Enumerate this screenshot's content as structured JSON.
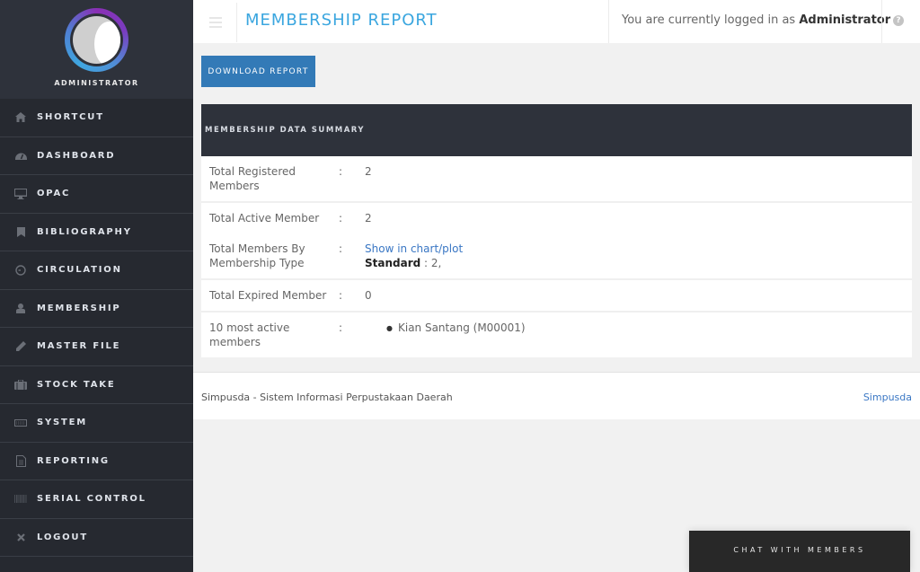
{
  "profile": {
    "name": "ADMINISTRATOR"
  },
  "sidebar": {
    "items": [
      {
        "label": "SHORTCUT",
        "icon": "home-icon"
      },
      {
        "label": "DASHBOARD",
        "icon": "dashboard-gauge-icon"
      },
      {
        "label": "OPAC",
        "icon": "monitor-icon"
      },
      {
        "label": "BIBLIOGRAPHY",
        "icon": "bookmark-icon"
      },
      {
        "label": "CIRCULATION",
        "icon": "clock-icon"
      },
      {
        "label": "MEMBERSHIP",
        "icon": "user-icon"
      },
      {
        "label": "MASTER FILE",
        "icon": "pencil-icon"
      },
      {
        "label": "STOCK TAKE",
        "icon": "briefcase-icon"
      },
      {
        "label": "SYSTEM",
        "icon": "keyboard-icon"
      },
      {
        "label": "REPORTING",
        "icon": "document-icon"
      },
      {
        "label": "SERIAL CONTROL",
        "icon": "barcode-icon"
      },
      {
        "label": "LOGOUT",
        "icon": "close-icon"
      }
    ]
  },
  "header": {
    "title": "MEMBERSHIP REPORT",
    "login_prefix": "You are currently logged in as",
    "login_user": "Administrator",
    "help_glyph": "?"
  },
  "toolbar": {
    "download_label": "DOWNLOAD REPORT"
  },
  "summary": {
    "title": "MEMBERSHIP DATA SUMMARY",
    "separator": ":",
    "rows": {
      "registered": {
        "label": "Total Registered Members",
        "value": "2"
      },
      "active": {
        "label": "Total Active Member",
        "value": "2"
      },
      "by_type": {
        "label": "Total Members By Membership Type",
        "link": "Show in chart/plot",
        "type_name": "Standard",
        "type_value": " : 2,"
      },
      "expired": {
        "label": "Total Expired Member",
        "value": "0"
      },
      "most_active": {
        "label": "10 most active members",
        "members": [
          "Kian Santang (M00001)"
        ]
      }
    }
  },
  "footer": {
    "text": "Simpusda - Sistem Informasi Perpustakaan Daerah",
    "link": "Simpusda"
  },
  "chat": {
    "label": "CHAT WITH MEMBERS"
  }
}
